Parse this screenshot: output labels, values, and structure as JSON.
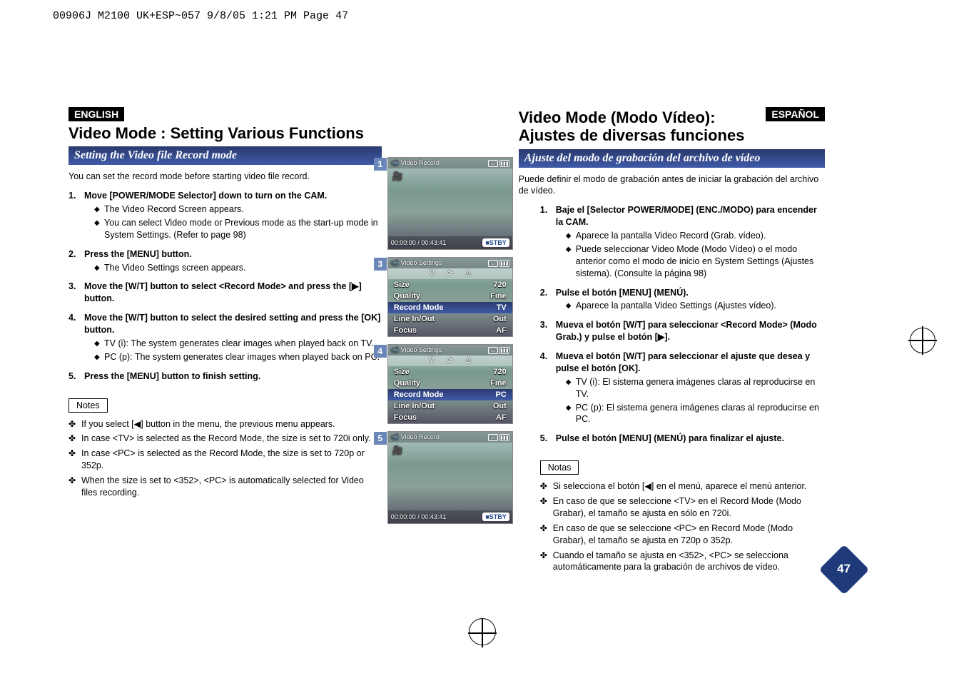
{
  "header_strip": "00906J M2100 UK+ESP~057  9/8/05 1:21 PM  Page 47",
  "left": {
    "lang": "ENGLISH",
    "title": "Video Mode : Setting Various Functions",
    "subtitle": "Setting the Video file Record mode",
    "intro": "You can set the record mode before starting video file record.",
    "steps": [
      {
        "head": "Move [POWER/MODE Selector] down to turn on the CAM.",
        "bullets": [
          "The Video Record Screen appears.",
          "You can select Video mode or Previous mode as the start-up mode in System Settings. (Refer to page 98)"
        ]
      },
      {
        "head": "Press the [MENU] button.",
        "bullets": [
          "The Video Settings screen appears."
        ]
      },
      {
        "head": "Move the [W/T] button to select <Record Mode> and press the [▶] button.",
        "bullets": []
      },
      {
        "head": "Move the [W/T] button to select the desired setting and press the [OK] button.",
        "bullets": [
          "TV (i): The system generates clear images when played back on TV.",
          "PC (p): The system generates clear images when played back on PC."
        ]
      },
      {
        "head": "Press the [MENU] button to finish setting.",
        "bullets": []
      }
    ],
    "notes_label": "Notes",
    "notes": [
      "If you select [◀] button in the menu, the previous menu appears.",
      "In case <TV> is selected as the Record Mode, the size is set to 720i only.",
      "In case <PC> is selected as the Record Mode, the size is set to 720p or 352p.",
      "When the size is set to <352>, <PC> is automatically selected for Video files recording."
    ]
  },
  "right": {
    "lang": "ESPAÑOL",
    "title": "Video Mode (Modo Vídeo): Ajustes de diversas funciones",
    "subtitle": "Ajuste del modo de grabación del archivo de vídeo",
    "intro": "Puede definir el modo de grabación antes de iniciar la grabación del archivo de vídeo.",
    "steps": [
      {
        "head": "Baje el [Selector POWER/MODE] (ENC./MODO) para encender la CAM.",
        "bullets": [
          "Aparece la pantalla Video Record (Grab. vídeo).",
          "Puede seleccionar Video Mode (Modo Vídeo) o el modo anterior como el modo de inicio en System Settings (Ajustes sistema). (Consulte la página 98)"
        ]
      },
      {
        "head": "Pulse el botón [MENU] (MENÚ).",
        "bullets": [
          "Aparece la pantalla Video Settings (Ajustes vídeo)."
        ]
      },
      {
        "head": "Mueva el botón [W/T] para seleccionar <Record Mode> (Modo Grab.) y pulse el botón [▶].",
        "bullets": []
      },
      {
        "head": "Mueva el botón [W/T] para seleccionar el ajuste que desea y pulse el botón [OK].",
        "bullets": [
          "TV (i): El sistema genera imágenes claras al reproducirse en TV.",
          "PC (p): El sistema genera imágenes claras al reproducirse en PC."
        ]
      },
      {
        "head": "Pulse el botón [MENU] (MENÚ) para finalizar el ajuste.",
        "bullets": []
      }
    ],
    "notes_label": "Notas",
    "notes": [
      "Si selecciona el botón [◀] en el menú, aparece el menú anterior.",
      "En caso de que se seleccione <TV> en el Record Mode (Modo Grabar), el tamaño se ajusta en sólo en 720i.",
      "En caso de que se seleccione <PC> en Record Mode (Modo Grabar), el tamaño se ajusta en 720p o 352p.",
      "Cuando el tamaño se ajusta en <352>, <PC> se selecciona automáticamente para la grabación de archivos de vídeo."
    ]
  },
  "shots": {
    "rec_title": "Video Record",
    "set_title": "Video Settings",
    "batt": "▮▮▮",
    "stby": "STBY",
    "time1": "00:00:00 / 00:43:41",
    "time5": "00:00:00 / 00:43:41",
    "rows": {
      "size_l": "Size",
      "size_v": "720",
      "qual_l": "Quality",
      "qual_v": "Fine",
      "rec_l": "Record Mode",
      "rec_v_tv": "TV",
      "rec_v_pc": "PC",
      "line_l": "Line In/Out",
      "line_v": "Out",
      "focus_l": "Focus",
      "focus_v": "AF"
    }
  },
  "page_num": "47"
}
